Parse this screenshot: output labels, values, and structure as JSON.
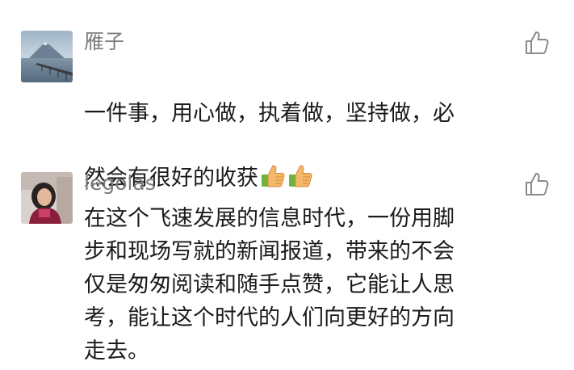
{
  "comments": [
    {
      "author": "雁子",
      "text": "一件事，用心做，执着做，坚持做，必\n然会有很好的收获",
      "emojis": [
        "thumbs-up-emoji",
        "thumbs-up-emoji"
      ]
    },
    {
      "author": "legolas",
      "text": "在这个飞速发展的信息时代，一份用脚\n步和现场写就的新闻报道，带来的不会\n仅是匆匆阅读和随手点赞，它能让人思\n考，能让这个时代的人们向更好的方向\n走去。"
    }
  ],
  "icons": {
    "like": "thumb-up-outline-icon"
  },
  "colors": {
    "author_name": "#7d7d7d",
    "body_text": "#1b1b1b",
    "icon_gray": "#8a8a8a"
  }
}
